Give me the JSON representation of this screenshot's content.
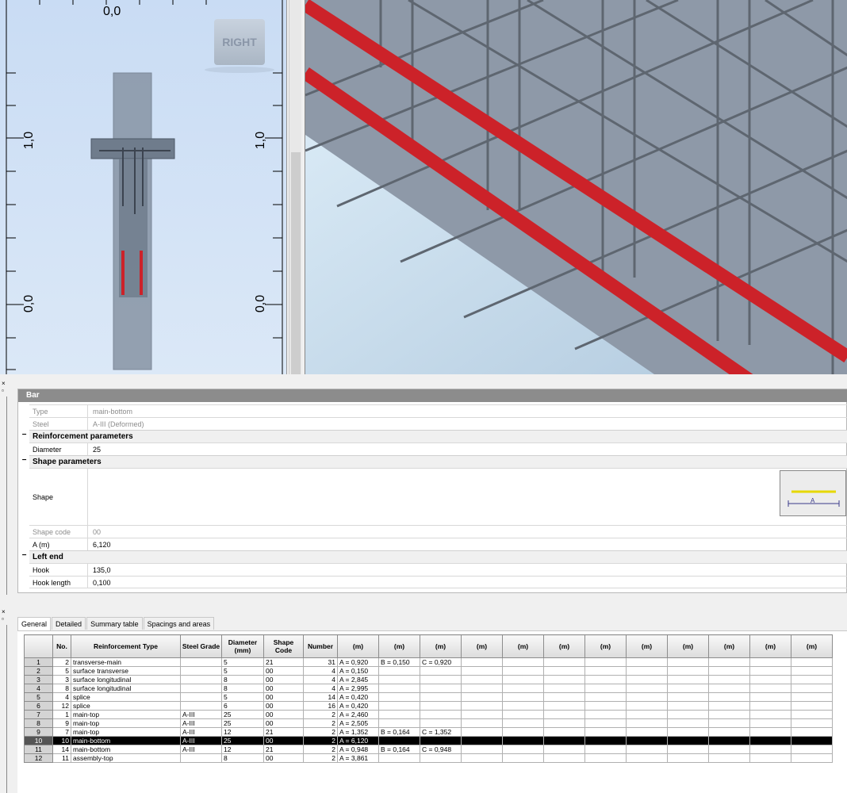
{
  "viewport_left": {
    "top_label": "0,0",
    "left_label_1": "1,0",
    "left_label_0": "0,0",
    "right_label_1": "1,0",
    "right_label_0": "0,0",
    "view_cube_label": "RIGHT"
  },
  "properties": {
    "header": "Bar",
    "type_label": "Type",
    "type_value": "main-bottom",
    "steel_label": "Steel",
    "steel_value": "A-III (Deformed)",
    "cat_reinforcement": "Reinforcement parameters",
    "diameter_label": "Diameter",
    "diameter_value": "25",
    "cat_shape": "Shape parameters",
    "shape_label": "Shape",
    "shape_preview_label": "A",
    "shape_code_label": "Shape code",
    "shape_code_value": "00",
    "a_label": "A (m)",
    "a_value": "6,120",
    "cat_left_end": "Left end",
    "hook_label": "Hook",
    "hook_value": "135,0",
    "hook_length_label": "Hook length",
    "hook_length_value": "0,100"
  },
  "tabs": [
    "General",
    "Detailed",
    "Summary table",
    "Spacings and areas"
  ],
  "grid": {
    "headers": [
      "No.",
      "Reinforcement Type",
      "Steel Grade",
      "Diameter (mm)",
      "Shape Code",
      "Number",
      "(m)",
      "(m)",
      "(m)",
      "(m)",
      "(m)",
      "(m)",
      "(m)",
      "(m)",
      "(m)",
      "(m)",
      "(m)",
      "(m)"
    ],
    "rows": [
      [
        "1",
        "2",
        "transverse-main",
        "",
        "5",
        "21",
        "31",
        "A = 0,920",
        "B = 0,150",
        "C = 0,920"
      ],
      [
        "2",
        "5",
        "surface transverse",
        "",
        "5",
        "00",
        "4",
        "A = 0,150",
        "",
        ""
      ],
      [
        "3",
        "3",
        "surface longitudinal",
        "",
        "8",
        "00",
        "4",
        "A = 2,845",
        "",
        ""
      ],
      [
        "4",
        "8",
        "surface longitudinal",
        "",
        "8",
        "00",
        "4",
        "A = 2,995",
        "",
        ""
      ],
      [
        "5",
        "4",
        "splice",
        "",
        "5",
        "00",
        "14",
        "A = 0,420",
        "",
        ""
      ],
      [
        "6",
        "12",
        "splice",
        "",
        "6",
        "00",
        "16",
        "A = 0,420",
        "",
        ""
      ],
      [
        "7",
        "1",
        "main-top",
        "A-III",
        "25",
        "00",
        "2",
        "A = 2,460",
        "",
        ""
      ],
      [
        "8",
        "9",
        "main-top",
        "A-III",
        "25",
        "00",
        "2",
        "A = 2,505",
        "",
        ""
      ],
      [
        "9",
        "7",
        "main-top",
        "A-III",
        "12",
        "21",
        "2",
        "A = 1,352",
        "B = 0,164",
        "C = 1,352"
      ],
      [
        "10",
        "10",
        "main-bottom",
        "A-III",
        "25",
        "00",
        "2",
        "A = 6,120",
        "",
        ""
      ],
      [
        "11",
        "14",
        "main-bottom",
        "A-III",
        "12",
        "21",
        "2",
        "A = 0,948",
        "B = 0,164",
        "C = 0,948"
      ],
      [
        "12",
        "11",
        "assembly-top",
        "",
        "8",
        "00",
        "2",
        "A = 3,861",
        "",
        ""
      ]
    ],
    "selected_row": 9
  },
  "colors": {
    "rebar_highlight": "#cc2229",
    "selection": "#000000"
  }
}
